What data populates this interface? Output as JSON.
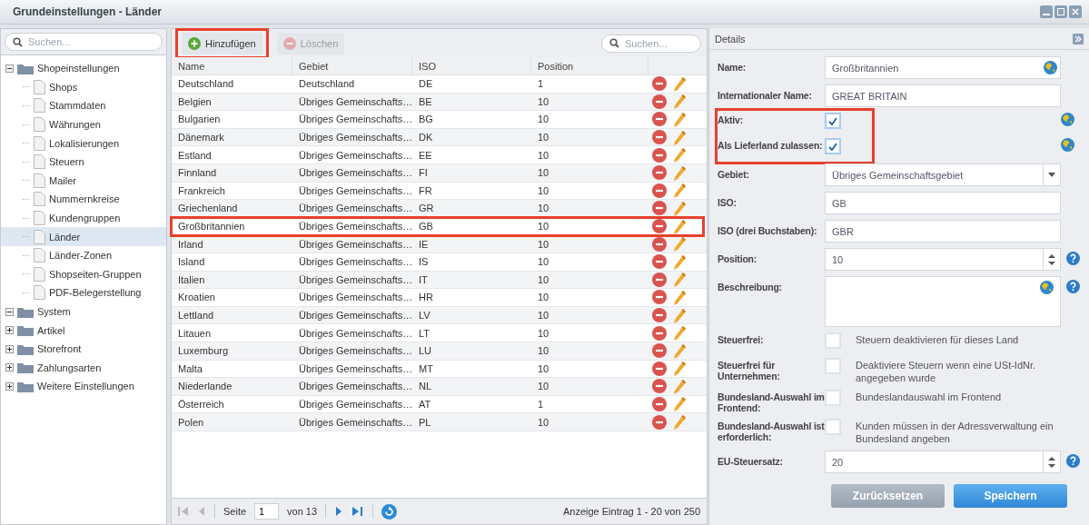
{
  "window": {
    "title": "Grundeinstellungen - Länder"
  },
  "tree": {
    "search_placeholder": "Suchen...",
    "items": [
      {
        "label": "Shopeinstellungen",
        "expanded": true,
        "children": [
          {
            "label": "Shops",
            "selected": false
          },
          {
            "label": "Stammdaten",
            "selected": false
          },
          {
            "label": "Währungen",
            "selected": false
          },
          {
            "label": "Lokalisierungen",
            "selected": false
          },
          {
            "label": "Steuern",
            "selected": false
          },
          {
            "label": "Mailer",
            "selected": false
          },
          {
            "label": "Nummernkreise",
            "selected": false
          },
          {
            "label": "Kundengruppen",
            "selected": false
          },
          {
            "label": "Länder",
            "selected": true
          },
          {
            "label": "Länder-Zonen",
            "selected": false
          },
          {
            "label": "Shopseiten-Gruppen",
            "selected": false
          },
          {
            "label": "PDF-Belegerstellung",
            "selected": false
          }
        ]
      },
      {
        "label": "System",
        "expanded": true
      },
      {
        "label": "Artikel",
        "expanded": false
      },
      {
        "label": "Storefront",
        "expanded": false
      },
      {
        "label": "Zahlungsarten",
        "expanded": false
      },
      {
        "label": "Weitere Einstellungen",
        "expanded": false
      }
    ]
  },
  "toolbar": {
    "buttons": [
      {
        "label": "Hinzufügen",
        "kind": "add",
        "disabled": false,
        "highlighted": true
      },
      {
        "label": "Löschen",
        "kind": "delete",
        "disabled": true
      }
    ],
    "search_placeholder": "Suchen..."
  },
  "table": {
    "columns": [
      "Name",
      "Gebiet",
      "ISO",
      "Position"
    ],
    "rows": [
      {
        "cells": [
          "Deutschland",
          "Deutschland",
          "DE",
          "1"
        ],
        "highlighted": false
      },
      {
        "cells": [
          "Belgien",
          "Übriges Gemeinschafts…",
          "BE",
          "10"
        ],
        "highlighted": false
      },
      {
        "cells": [
          "Bulgarien",
          "Übriges Gemeinschafts…",
          "BG",
          "10"
        ],
        "highlighted": false
      },
      {
        "cells": [
          "Dänemark",
          "Übriges Gemeinschafts…",
          "DK",
          "10"
        ],
        "highlighted": false
      },
      {
        "cells": [
          "Estland",
          "Übriges Gemeinschafts…",
          "EE",
          "10"
        ],
        "highlighted": false
      },
      {
        "cells": [
          "Finnland",
          "Übriges Gemeinschafts…",
          "FI",
          "10"
        ],
        "highlighted": false
      },
      {
        "cells": [
          "Frankreich",
          "Übriges Gemeinschafts…",
          "FR",
          "10"
        ],
        "highlighted": false
      },
      {
        "cells": [
          "Griechenland",
          "Übriges Gemeinschafts…",
          "GR",
          "10"
        ],
        "highlighted": false
      },
      {
        "cells": [
          "Großbritannien",
          "Übriges Gemeinschafts…",
          "GB",
          "10"
        ],
        "highlighted": true
      },
      {
        "cells": [
          "Irland",
          "Übriges Gemeinschafts…",
          "IE",
          "10"
        ],
        "highlighted": false
      },
      {
        "cells": [
          "Island",
          "Übriges Gemeinschafts…",
          "IS",
          "10"
        ],
        "highlighted": false
      },
      {
        "cells": [
          "Italien",
          "Übriges Gemeinschafts…",
          "IT",
          "10"
        ],
        "highlighted": false
      },
      {
        "cells": [
          "Kroatien",
          "Übriges Gemeinschafts…",
          "HR",
          "10"
        ],
        "highlighted": false
      },
      {
        "cells": [
          "Lettland",
          "Übriges Gemeinschafts…",
          "LV",
          "10"
        ],
        "highlighted": false
      },
      {
        "cells": [
          "Litauen",
          "Übriges Gemeinschafts…",
          "LT",
          "10"
        ],
        "highlighted": false
      },
      {
        "cells": [
          "Luxemburg",
          "Übriges Gemeinschafts…",
          "LU",
          "10"
        ],
        "highlighted": false
      },
      {
        "cells": [
          "Malta",
          "Übriges Gemeinschafts…",
          "MT",
          "10"
        ],
        "highlighted": false
      },
      {
        "cells": [
          "Niederlande",
          "Übriges Gemeinschafts…",
          "NL",
          "10"
        ],
        "highlighted": false
      },
      {
        "cells": [
          "Österreich",
          "Übriges Gemeinschafts…",
          "AT",
          "1"
        ],
        "highlighted": false
      },
      {
        "cells": [
          "Polen",
          "Übriges Gemeinschafts…",
          "PL",
          "10"
        ],
        "highlighted": false
      }
    ]
  },
  "pager": {
    "page_label": "Seite",
    "page": "1",
    "of": "von 13",
    "summary": "Anzeige Eintrag 1 - 20 von 250"
  },
  "details": {
    "title": "Details",
    "sections": [
      {
        "highlighted": false,
        "fields": [
          {
            "kind": "text",
            "label": "Name:",
            "value": "Großbritannien",
            "globe": true
          },
          {
            "kind": "text",
            "label": "Internationaler Name:",
            "value": "GREAT BRITAIN"
          }
        ]
      },
      {
        "highlighted": true,
        "fields": [
          {
            "kind": "checkbox",
            "label": "Aktiv:",
            "checked": true,
            "globe": true
          },
          {
            "kind": "checkbox",
            "label": "Als Lieferland zulassen:",
            "checked": true,
            "globe": true
          }
        ]
      },
      {
        "highlighted": false,
        "fields": [
          {
            "kind": "select",
            "label": "Gebiet:",
            "value": "Übriges Gemeinschaftsgebiet"
          },
          {
            "kind": "text",
            "label": "ISO:",
            "value": "GB"
          },
          {
            "kind": "text",
            "label": "ISO (drei Buchstaben):",
            "value": "GBR"
          },
          {
            "kind": "number",
            "label": "Position:",
            "value": "10",
            "help": true
          },
          {
            "kind": "textarea",
            "label": "Beschreibung:",
            "globe": true,
            "help": true
          },
          {
            "kind": "checkbox",
            "label": "Steuerfrei:",
            "checked": false,
            "description": "Steuern deaktivieren für dieses Land"
          },
          {
            "kind": "checkbox",
            "label": "Steuerfrei für Unternehmen:",
            "checked": false,
            "description": "Deaktiviere Steuern wenn eine USt-IdNr. angegeben wurde"
          },
          {
            "kind": "checkbox",
            "label": "Bundesland-Auswahl im Frontend:",
            "checked": false,
            "description": "Bundeslandauswahl im Frontend"
          },
          {
            "kind": "checkbox",
            "label": "Bundesland-Auswahl ist erforderlich:",
            "checked": false,
            "description": "Kunden müssen in der Adressverwaltung ein Bundesland angeben"
          },
          {
            "kind": "number",
            "label": "EU-Steuersatz:",
            "value": "20",
            "help": true
          }
        ]
      }
    ],
    "buttons": [
      {
        "label": "Zurücksetzen",
        "kind": "secondary"
      },
      {
        "label": "Speichern",
        "kind": "primary"
      }
    ]
  }
}
